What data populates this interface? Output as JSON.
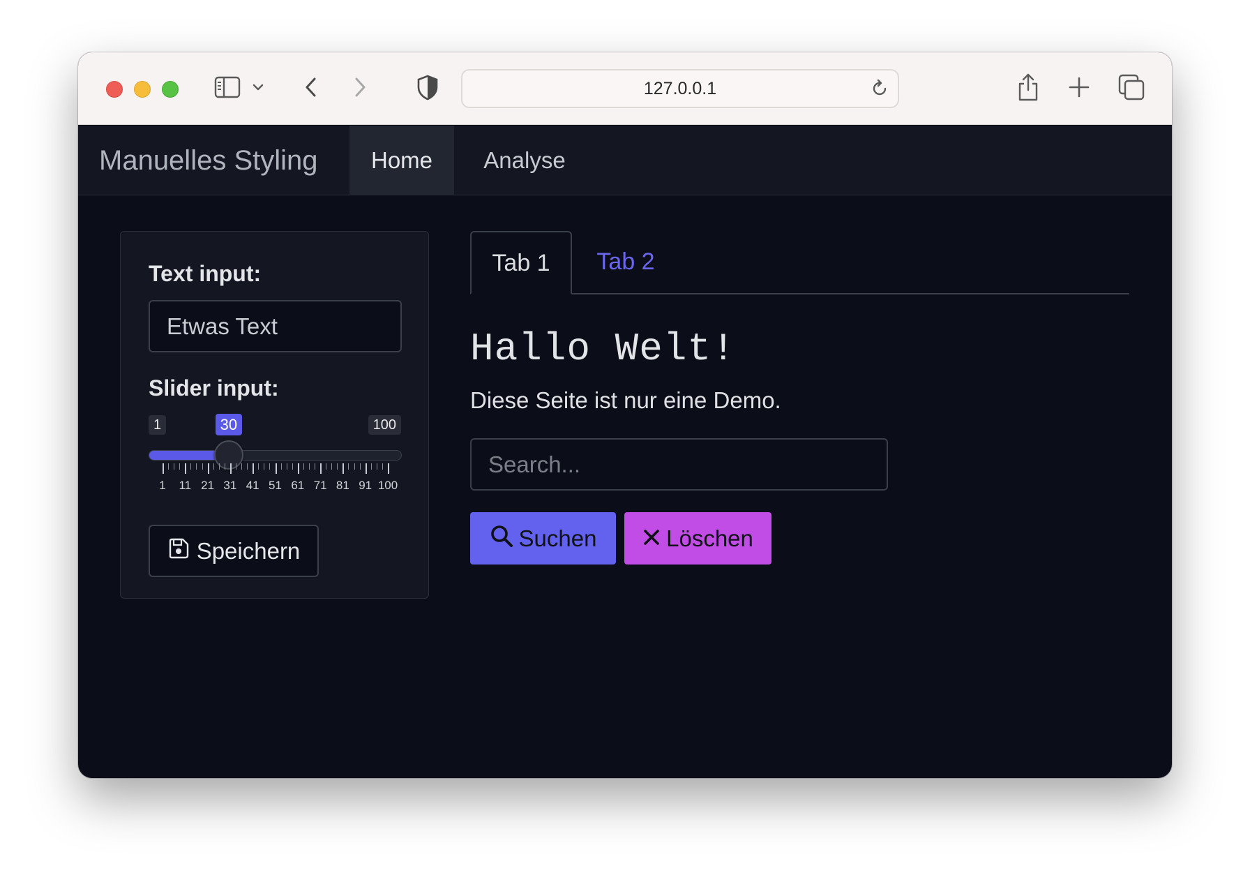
{
  "browser": {
    "url": "127.0.0.1",
    "icons": [
      "sidebar-toggle-icon",
      "chevron-down-icon",
      "back-icon",
      "forward-icon",
      "shield-icon",
      "reload-icon",
      "share-icon",
      "plus-icon",
      "tabs-overview-icon"
    ]
  },
  "navbar": {
    "brand": "Manuelles Styling",
    "items": [
      {
        "label": "Home",
        "active": true
      },
      {
        "label": "Analyse",
        "active": false
      }
    ]
  },
  "sidebar": {
    "text_label": "Text input:",
    "text_value": "Etwas Text",
    "slider_label": "Slider input:",
    "slider": {
      "min": 1,
      "max": 100,
      "value": 30,
      "min_label": "1",
      "max_label": "100",
      "value_label": "30",
      "tick_labels": [
        "1",
        "11",
        "21",
        "31",
        "41",
        "51",
        "61",
        "71",
        "81",
        "91",
        "100"
      ]
    },
    "save_label": "Speichern"
  },
  "main": {
    "tabs": [
      {
        "label": "Tab 1",
        "active": true
      },
      {
        "label": "Tab 2",
        "active": false
      }
    ],
    "heading": "Hallo Welt!",
    "subtext": "Diese Seite ist nur eine Demo.",
    "search_placeholder": "Search...",
    "search_button": "Suchen",
    "delete_button": "Löschen"
  },
  "colors": {
    "primary": "#6262ef",
    "secondary": "#c24ce6",
    "background": "#0b0e18",
    "card": "#141721"
  }
}
